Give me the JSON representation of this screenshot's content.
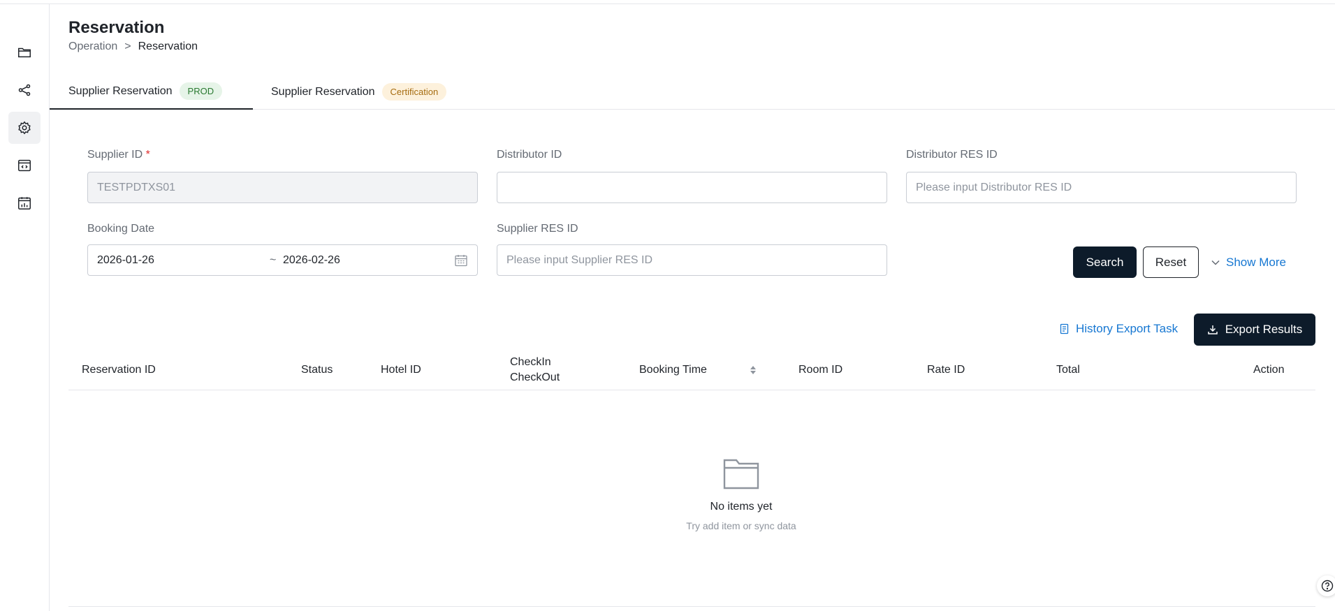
{
  "page": {
    "title": "Reservation",
    "breadcrumb": {
      "parent": "Operation",
      "separator": ">",
      "current": "Reservation"
    }
  },
  "sidebar": {
    "items": [
      {
        "icon": "folder-icon",
        "active": false
      },
      {
        "icon": "share-icon",
        "active": false
      },
      {
        "icon": "gear-icon",
        "active": true
      },
      {
        "icon": "code-window-icon",
        "active": false
      },
      {
        "icon": "calendar-chart-icon",
        "active": false
      }
    ]
  },
  "tabs": [
    {
      "label": "Supplier Reservation",
      "badge": "PROD",
      "active": true
    },
    {
      "label": "Supplier Reservation",
      "badge": "Certification",
      "active": false
    }
  ],
  "form": {
    "supplier_id": {
      "label": "Supplier ID",
      "required_mark": "*",
      "value": "TESTPDTXS01"
    },
    "distributor_id": {
      "label": "Distributor ID",
      "value": ""
    },
    "distributor_res_id": {
      "label": "Distributor RES ID",
      "placeholder": "Please input Distributor RES ID"
    },
    "booking_date": {
      "label": "Booking Date",
      "from": "2026-01-26",
      "separator": "~",
      "to": "2026-02-26"
    },
    "supplier_res_id": {
      "label": "Supplier RES ID",
      "placeholder": "Please input Supplier RES ID"
    }
  },
  "actions": {
    "search": "Search",
    "reset": "Reset",
    "show_more": "Show More",
    "history_export": "History Export Task",
    "export_results": "Export Results"
  },
  "table": {
    "columns": [
      "Reservation ID",
      "Status",
      "Hotel ID",
      "CheckIn",
      "CheckOut",
      "Booking Time",
      "Room ID",
      "Rate ID",
      "Total",
      "Action"
    ]
  },
  "empty_state": {
    "title": "No items yet",
    "subtitle": "Try add item or sync data"
  },
  "colors": {
    "primary_dark": "#0d1b2a",
    "link_blue": "#1677d2",
    "prod_badge_bg": "#e6f4e8",
    "cert_badge_bg": "#fdf1dc"
  }
}
